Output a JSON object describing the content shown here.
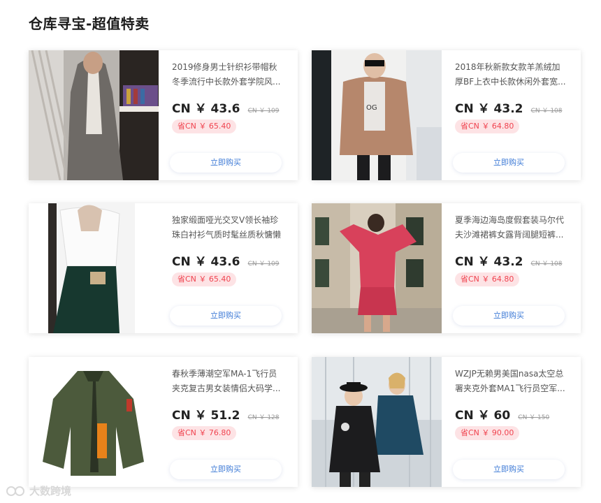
{
  "page": {
    "title": "仓库寻宝-超值特卖"
  },
  "products": [
    {
      "name": "2019修身男士针织衫带帽秋冬季流行中长款外套学院风...",
      "price": "CN ￥ 43.6",
      "original_price": "CN ￥ 109",
      "savings": "省CN ￥ 65.40",
      "buy_label": "立即购买"
    },
    {
      "name": "2018年秋新款女款羊羔绒加厚BF上衣中长款休闲外套宽...",
      "price": "CN ￥ 43.2",
      "original_price": "CN ￥ 108",
      "savings": "省CN ￥ 64.80",
      "buy_label": "立即购买"
    },
    {
      "name": "独家缎面哑光交叉V领长袖珍珠白衬衫气质时髦丝质秋慵懒",
      "price": "CN ￥ 43.6",
      "original_price": "CN ￥ 109",
      "savings": "省CN ￥ 65.40",
      "buy_label": "立即购买"
    },
    {
      "name": "夏季海边海岛度假套装马尔代夫沙滩裙裤女露背阔腿短裤...",
      "price": "CN ￥ 43.2",
      "original_price": "CN ￥ 108",
      "savings": "省CN ￥ 64.80",
      "buy_label": "立即购买"
    },
    {
      "name": "春秋季薄潮空军MA-1飞行员夹克复古男女装情侣大码学...",
      "price": "CN ￥ 51.2",
      "original_price": "CN ￥ 128",
      "savings": "省CN ￥ 76.80",
      "buy_label": "立即购买"
    },
    {
      "name": "WZJP无赖男美国nasa太空总署夹克外套MA1飞行员空军...",
      "price": "CN ￥ 60",
      "original_price": "CN ￥ 150",
      "savings": "省CN ￥ 90.00",
      "buy_label": "立即购买"
    }
  ],
  "watermark": {
    "text": "大数跨境"
  },
  "colors": {
    "price": "#222222",
    "savings_bg": "#fde3e5",
    "savings_text": "#f0434f",
    "button_text": "#3d7ad6"
  }
}
